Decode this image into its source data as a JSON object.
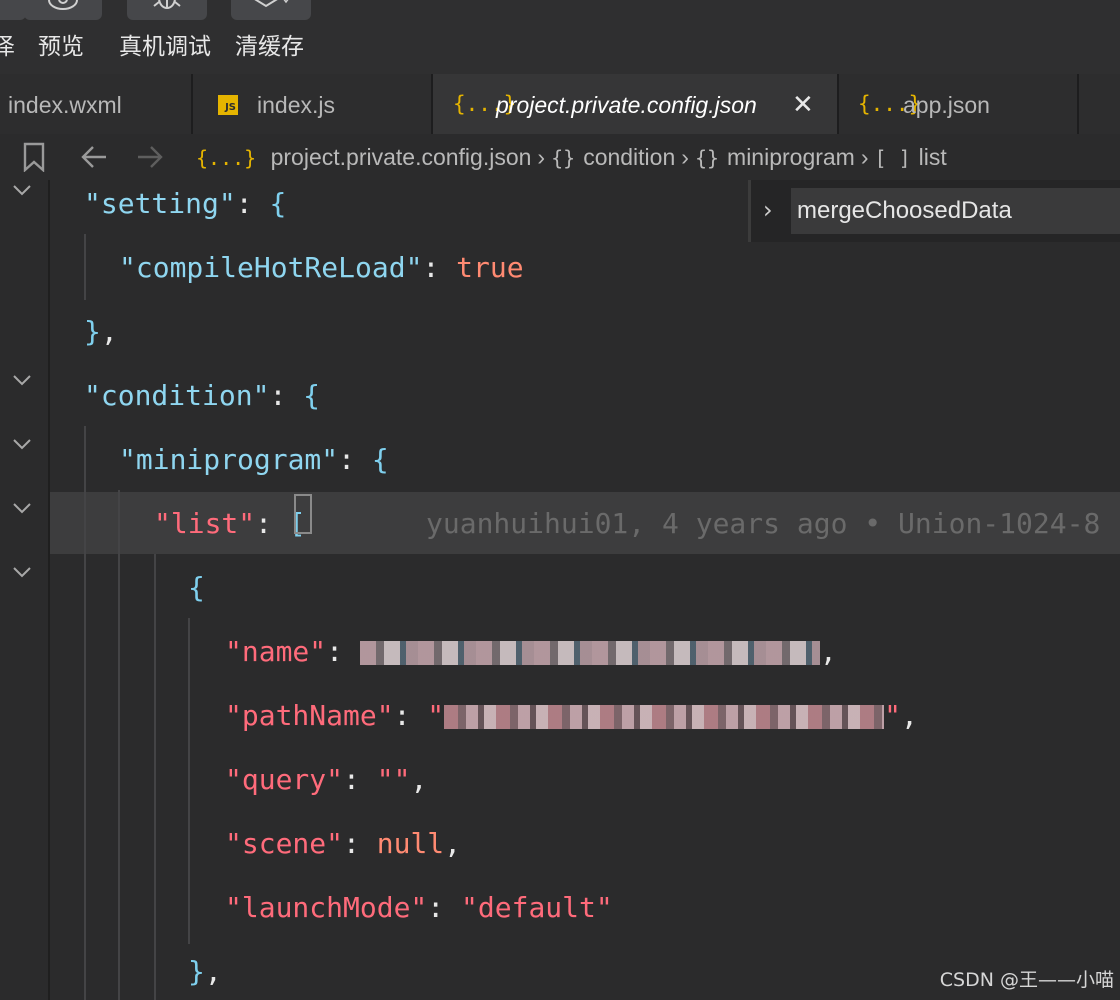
{
  "toolbar": {
    "items": [
      {
        "label": "泽"
      },
      {
        "label": "预览"
      },
      {
        "label": "真机调试"
      },
      {
        "label": "清缓存"
      }
    ]
  },
  "tabs": [
    {
      "label": "index.wxml",
      "icon": "code-icon",
      "active": false
    },
    {
      "label": "index.js",
      "icon": "js-icon",
      "active": false
    },
    {
      "label": "project.private.config.json",
      "icon": "json-braces-icon",
      "active": true
    },
    {
      "label": "app.json",
      "icon": "json-braces-icon",
      "active": false
    }
  ],
  "tab_icon_glyph": "{...}",
  "js_badge": "JS",
  "breadcrumb": {
    "file": "project.private.config.json",
    "path": [
      {
        "kind": "{}",
        "label": "condition"
      },
      {
        "kind": "{}",
        "label": "miniprogram"
      },
      {
        "kind": "[ ]",
        "label": "list"
      }
    ]
  },
  "outline": {
    "value": "mergeChoosedData"
  },
  "code": {
    "setting_key": "\"setting\"",
    "compile_key": "\"compileHotReLoad\"",
    "compile_val": "true",
    "condition_key": "\"condition\"",
    "miniprogram_key": "\"miniprogram\"",
    "list_key": "\"list\"",
    "name_key": "\"name\"",
    "pathName_key": "\"pathName\"",
    "query_key": "\"query\"",
    "query_val": "\"\"",
    "scene_key": "\"scene\"",
    "scene_val": "null",
    "launchMode_key": "\"launchMode\"",
    "launchMode_val": "\"default\""
  },
  "blame": "yuanhuihui01, 4 years ago • Union-1024-8",
  "watermark": "CSDN @王——小喵",
  "colors": {
    "accent_icon": "#e5b400",
    "key_blue": "#8fd6f0",
    "key_red": "#ff6b7b",
    "value_orange": "#ff8a72"
  }
}
